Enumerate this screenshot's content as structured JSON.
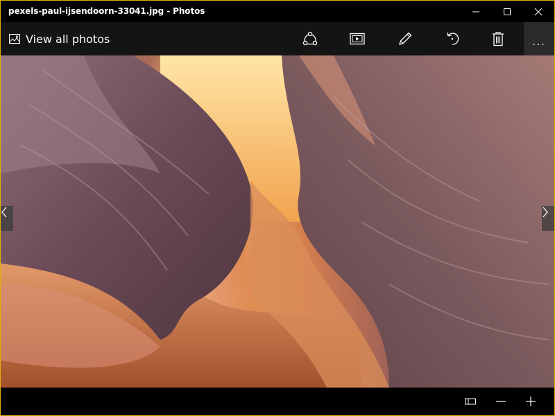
{
  "window": {
    "title": "pexels-paul-ijsendoorn-33041.jpg - Photos",
    "accent_border": "#e1b000"
  },
  "title_controls": {
    "minimize_icon": "minimize-icon",
    "maximize_icon": "maximize-icon",
    "close_icon": "close-icon"
  },
  "toolbar": {
    "view_all_label": "View all photos",
    "view_all_icon": "photo-icon",
    "buttons": [
      {
        "icon": "share-icon"
      },
      {
        "icon": "slideshow-icon"
      },
      {
        "icon": "edit-pencil-icon"
      },
      {
        "icon": "rotate-icon"
      },
      {
        "icon": "delete-icon"
      }
    ],
    "more_label": "...",
    "background": "#141414"
  },
  "photo": {
    "subject_colors": [
      "#6e4a56",
      "#c27a56",
      "#e9a55c",
      "#ffe8a8"
    ]
  },
  "navigation": {
    "prev_icon": "chevron-left-icon",
    "next_icon": "chevron-right-icon"
  },
  "bottombar": {
    "buttons": [
      {
        "icon": "fit-to-window-icon"
      },
      {
        "icon": "zoom-out-icon"
      },
      {
        "icon": "zoom-in-icon"
      }
    ]
  }
}
